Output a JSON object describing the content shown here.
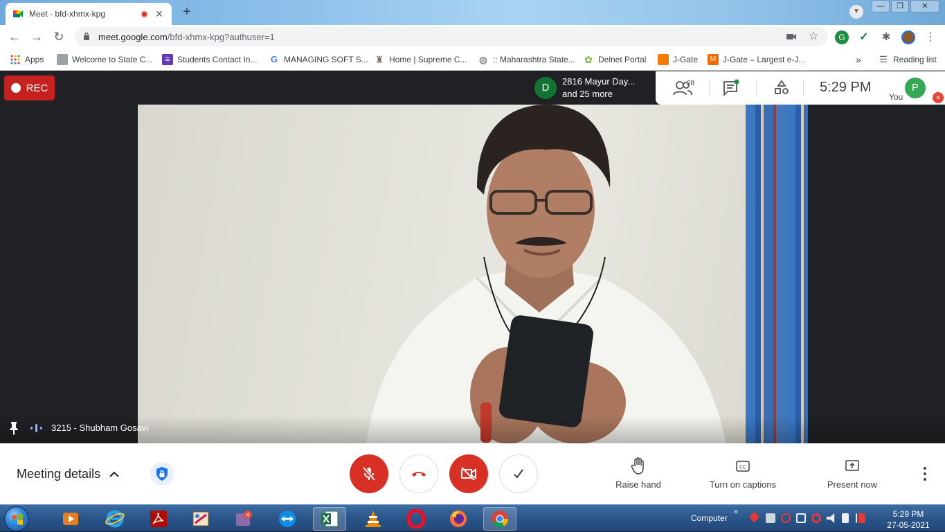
{
  "browser": {
    "tab_title": "Meet - bfd-xhmx-kpg",
    "tab_close": "✕",
    "new_tab": "+",
    "url_host": "meet.google.com",
    "url_path": "/bfd-xhmx-kpg?authuser=1",
    "window_controls": {
      "minimize": "—",
      "maximize": "❐",
      "close": "✕"
    },
    "reading_list": "Reading list",
    "bookmarks_overflow": "»",
    "bookmarks": [
      {
        "label": "Apps"
      },
      {
        "label": "Welcome to State C..."
      },
      {
        "label": "Students Contact In..."
      },
      {
        "label": "MANAGING SOFT S..."
      },
      {
        "label": "Home | Supreme C..."
      },
      {
        "label": ":: Maharashtra State..."
      },
      {
        "label": "Delnet Portal"
      },
      {
        "label": "J-Gate"
      },
      {
        "label": "J-Gate – Largest e-J..."
      }
    ]
  },
  "meet": {
    "rec_label": "REC",
    "presenter": {
      "initial": "D",
      "line1": "2816 Mayur Day...",
      "line2": "and 25 more"
    },
    "participants_count": "28",
    "clock": "5:29 PM",
    "you_label": "You",
    "you_initial": "P",
    "tile_name": "3215 - Shubham Gosavi",
    "controls": {
      "meeting_details": "Meeting details",
      "raise_hand": "Raise hand",
      "captions": "Turn on captions",
      "present": "Present now"
    }
  },
  "taskbar": {
    "tray_label": "Computer",
    "tray_expand": "»",
    "time": "5:29 PM",
    "date": "27-05-2021"
  },
  "colors": {
    "meet_red": "#d93025",
    "rec_red": "#c5221f",
    "you_avatar": "#34a853",
    "presenter_avatar": "#137333",
    "meet_dark": "#202124"
  }
}
